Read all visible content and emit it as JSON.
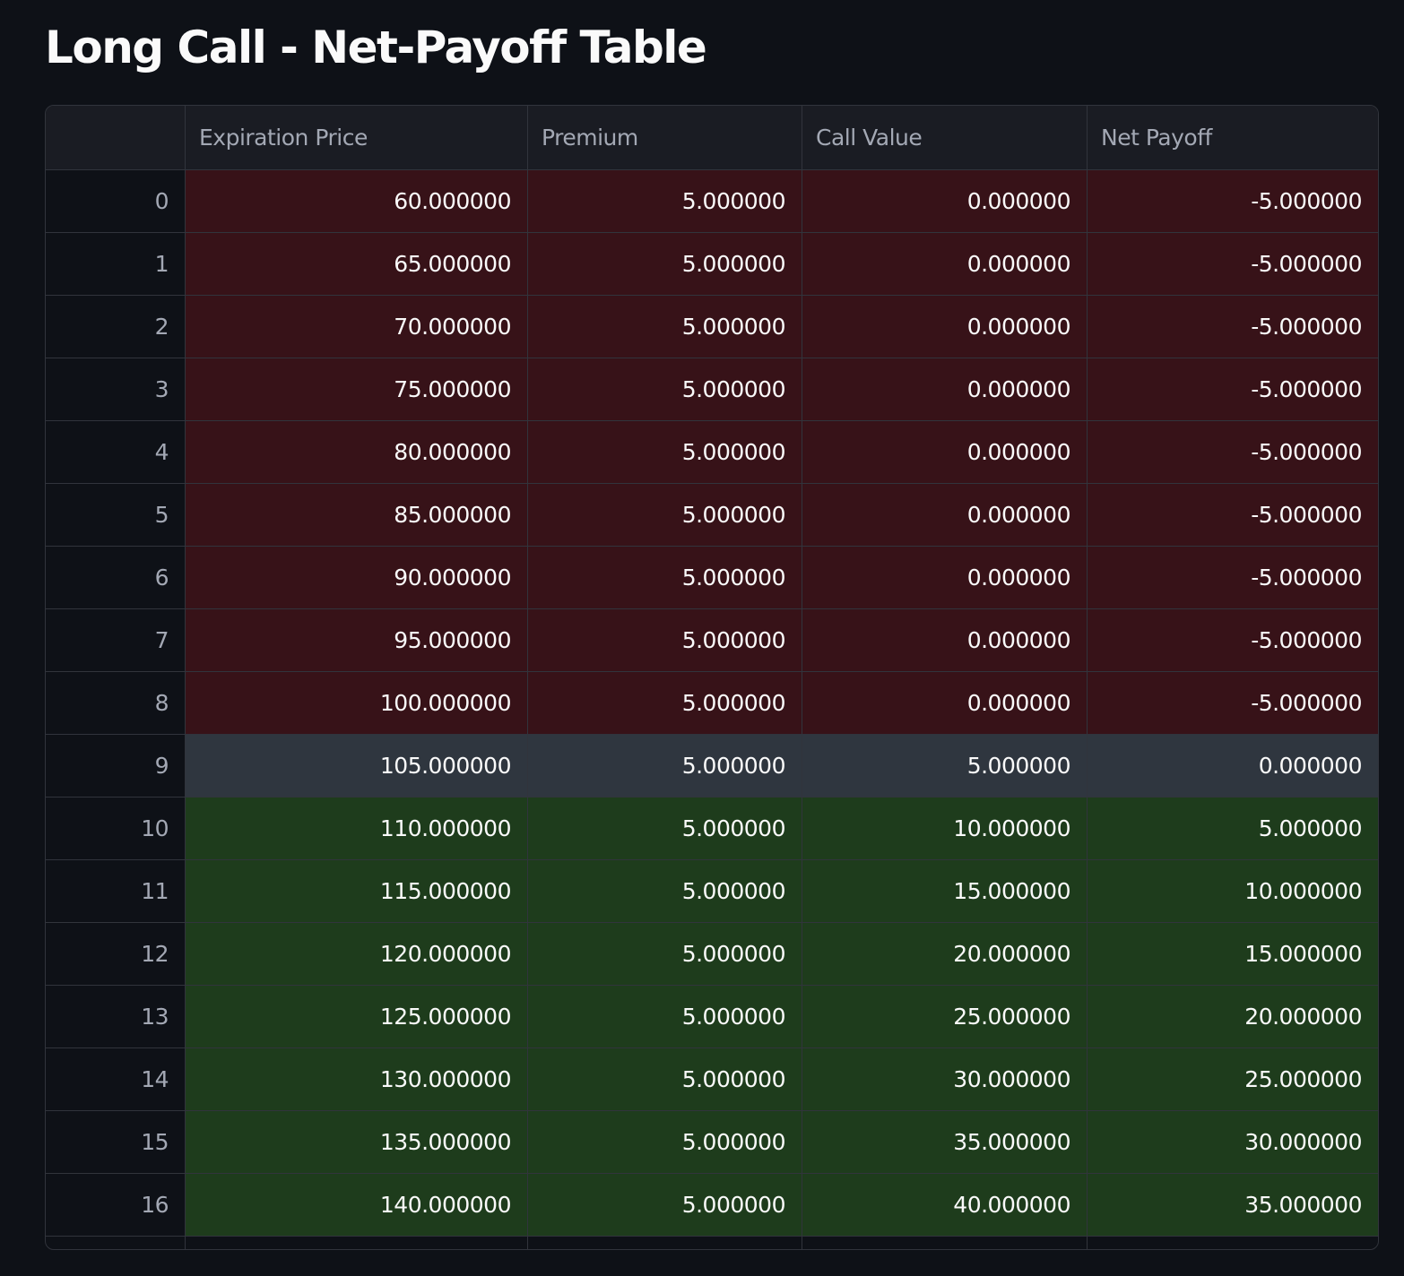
{
  "title": "Long Call - Net-Payoff Table",
  "colors": {
    "background": "#0e1117",
    "loss_row": "#371218",
    "breakeven_row": "#2f363f",
    "gain_row": "#1e3c1c"
  },
  "table": {
    "columns": [
      "",
      "Expiration Price",
      "Premium",
      "Call Value",
      "Net Payoff"
    ],
    "rows": [
      {
        "index": "0",
        "expiration_price": "60.000000",
        "premium": "5.000000",
        "call_value": "0.000000",
        "net_payoff": "-5.000000",
        "status": "loss"
      },
      {
        "index": "1",
        "expiration_price": "65.000000",
        "premium": "5.000000",
        "call_value": "0.000000",
        "net_payoff": "-5.000000",
        "status": "loss"
      },
      {
        "index": "2",
        "expiration_price": "70.000000",
        "premium": "5.000000",
        "call_value": "0.000000",
        "net_payoff": "-5.000000",
        "status": "loss"
      },
      {
        "index": "3",
        "expiration_price": "75.000000",
        "premium": "5.000000",
        "call_value": "0.000000",
        "net_payoff": "-5.000000",
        "status": "loss"
      },
      {
        "index": "4",
        "expiration_price": "80.000000",
        "premium": "5.000000",
        "call_value": "0.000000",
        "net_payoff": "-5.000000",
        "status": "loss"
      },
      {
        "index": "5",
        "expiration_price": "85.000000",
        "premium": "5.000000",
        "call_value": "0.000000",
        "net_payoff": "-5.000000",
        "status": "loss"
      },
      {
        "index": "6",
        "expiration_price": "90.000000",
        "premium": "5.000000",
        "call_value": "0.000000",
        "net_payoff": "-5.000000",
        "status": "loss"
      },
      {
        "index": "7",
        "expiration_price": "95.000000",
        "premium": "5.000000",
        "call_value": "0.000000",
        "net_payoff": "-5.000000",
        "status": "loss"
      },
      {
        "index": "8",
        "expiration_price": "100.000000",
        "premium": "5.000000",
        "call_value": "0.000000",
        "net_payoff": "-5.000000",
        "status": "loss"
      },
      {
        "index": "9",
        "expiration_price": "105.000000",
        "premium": "5.000000",
        "call_value": "5.000000",
        "net_payoff": "0.000000",
        "status": "even"
      },
      {
        "index": "10",
        "expiration_price": "110.000000",
        "premium": "5.000000",
        "call_value": "10.000000",
        "net_payoff": "5.000000",
        "status": "gain"
      },
      {
        "index": "11",
        "expiration_price": "115.000000",
        "premium": "5.000000",
        "call_value": "15.000000",
        "net_payoff": "10.000000",
        "status": "gain"
      },
      {
        "index": "12",
        "expiration_price": "120.000000",
        "premium": "5.000000",
        "call_value": "20.000000",
        "net_payoff": "15.000000",
        "status": "gain"
      },
      {
        "index": "13",
        "expiration_price": "125.000000",
        "premium": "5.000000",
        "call_value": "25.000000",
        "net_payoff": "20.000000",
        "status": "gain"
      },
      {
        "index": "14",
        "expiration_price": "130.000000",
        "premium": "5.000000",
        "call_value": "30.000000",
        "net_payoff": "25.000000",
        "status": "gain"
      },
      {
        "index": "15",
        "expiration_price": "135.000000",
        "premium": "5.000000",
        "call_value": "35.000000",
        "net_payoff": "30.000000",
        "status": "gain"
      },
      {
        "index": "16",
        "expiration_price": "140.000000",
        "premium": "5.000000",
        "call_value": "40.000000",
        "net_payoff": "35.000000",
        "status": "gain"
      }
    ]
  }
}
